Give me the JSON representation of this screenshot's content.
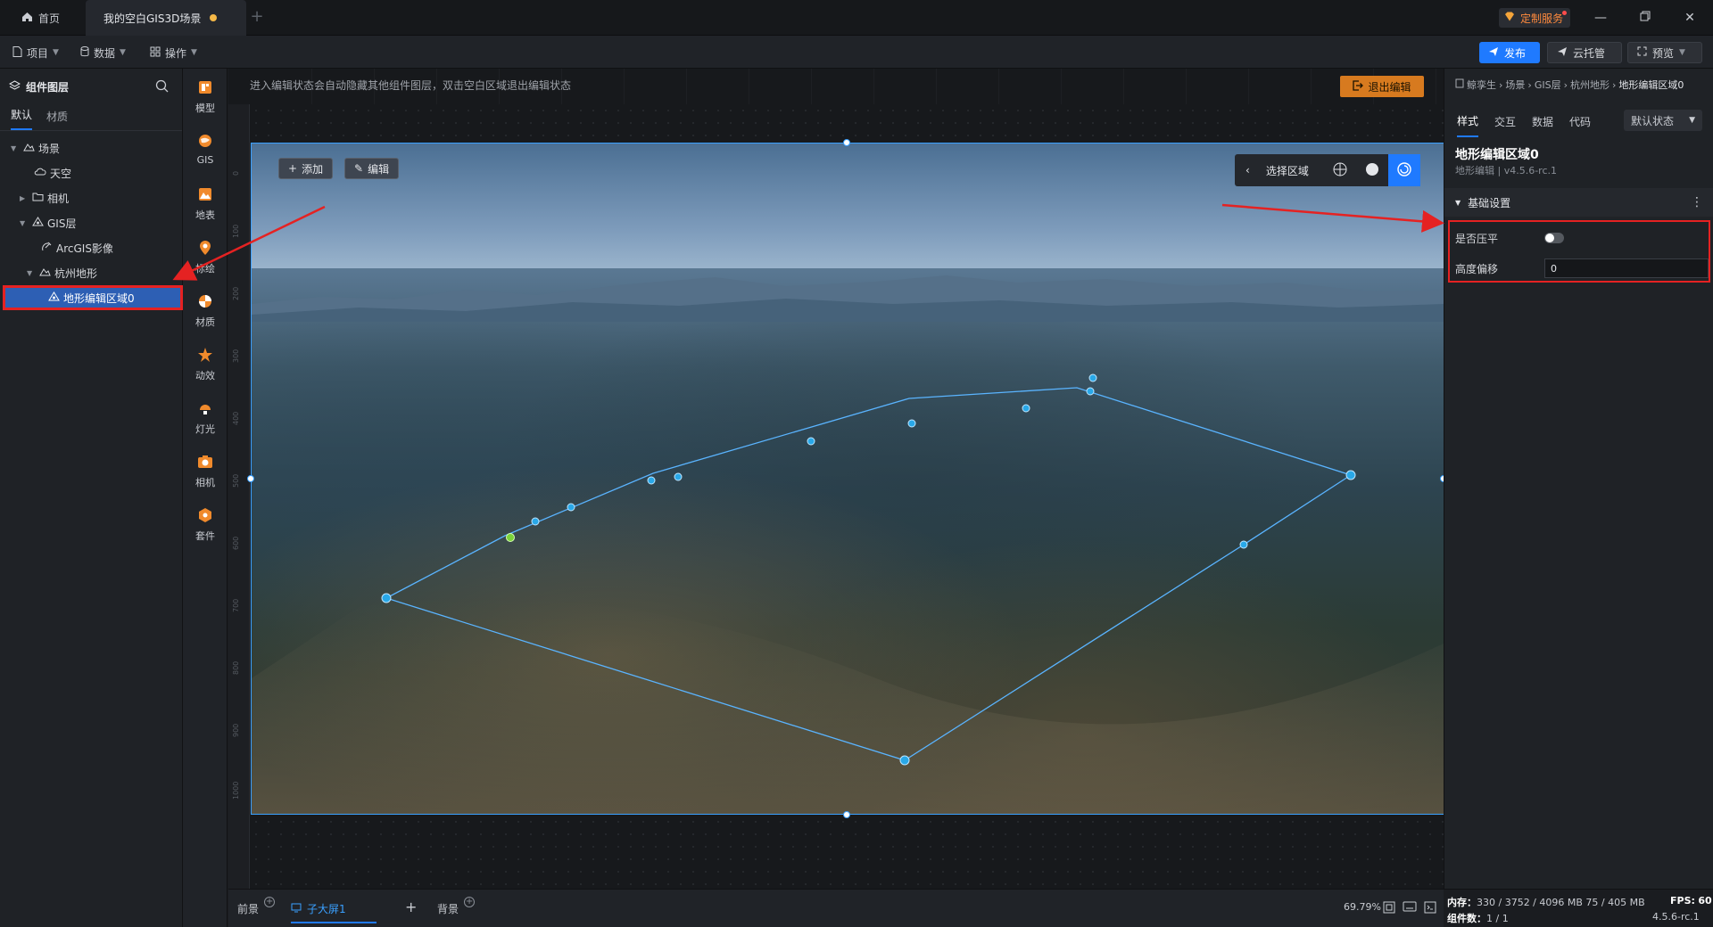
{
  "titlebar": {
    "home_label": "首页",
    "scene_tab_label": "我的空白GIS3D场景",
    "service_label": "定制服务",
    "colors": {
      "unsaved_dot": "#f5b847",
      "service_text": "#ff8a3d"
    }
  },
  "menubar": {
    "project": "项目",
    "data": "数据",
    "operate": "操作",
    "publish": "发布",
    "cloud": "云托管",
    "preview": "预览",
    "accent": "#1f7aff"
  },
  "layers": {
    "title": "组件图层",
    "tab_default": "默认",
    "tab_material": "材质",
    "tree": {
      "scene": "场景",
      "sky": "天空",
      "camera": "相机",
      "gis_layer": "GIS层",
      "arcgis": "ArcGIS影像",
      "hangzhou_terrain": "杭州地形",
      "terrain_region": "地形编辑区域0"
    }
  },
  "tools": {
    "model": "模型",
    "gis": "GIS",
    "surface": "地表",
    "marker": "标绘",
    "material": "材质",
    "effect": "动效",
    "light": "灯光",
    "camera": "相机",
    "kit": "套件"
  },
  "canvas": {
    "hint": "进入编辑状态会自动隐藏其他组件图层，双击空白区域退出编辑状态",
    "exit_edit": "退出编辑",
    "add": "添加",
    "edit": "编辑",
    "select_region": "选择区域",
    "ruler_left": [
      "0",
      "100",
      "200",
      "300",
      "400",
      "500",
      "600",
      "700",
      "800",
      "900",
      "1000"
    ]
  },
  "bottombar": {
    "foreground": "前景",
    "subscreen": "子大屏1",
    "background": "背景",
    "zoom": "69.79%"
  },
  "inspector": {
    "breadcrumb": [
      "鲸孪生",
      "场景",
      "GIS层",
      "杭州地形",
      "地形编辑区域0"
    ],
    "tabs": [
      "样式",
      "交互",
      "数据",
      "代码"
    ],
    "state": "默认状态",
    "component_name": "地形编辑区域0",
    "component_sub": "地形编辑 | v4.5.6-rc.1",
    "section": "基础设置",
    "flatten_label": "是否压平",
    "flatten_on": false,
    "height_offset_label": "高度偏移",
    "height_offset_value": "0"
  },
  "status": {
    "memory_label": "内存：",
    "memory_value": "330 / 3752 / 4096 MB  75 / 405 MB",
    "fps_label": "FPS:",
    "fps_value": "60",
    "components_label": "组件数：",
    "components_value": "1 / 1",
    "version": "4.5.6-rc.1"
  }
}
